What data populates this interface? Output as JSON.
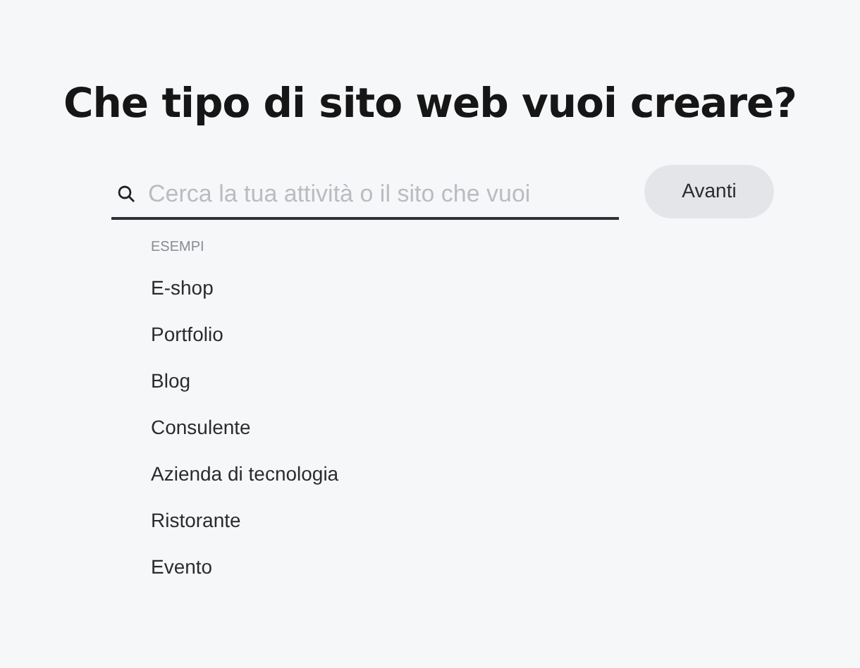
{
  "title": "Che tipo di sito web vuoi creare?",
  "search": {
    "placeholder": "Cerca la tua attività o il sito che vuoi"
  },
  "button": "Avanti",
  "examples": {
    "heading": "ESEMPI",
    "items": [
      "E-shop",
      "Portfolio",
      "Blog",
      "Consulente",
      "Azienda di tecnologia",
      "Ristorante",
      "Evento"
    ]
  }
}
